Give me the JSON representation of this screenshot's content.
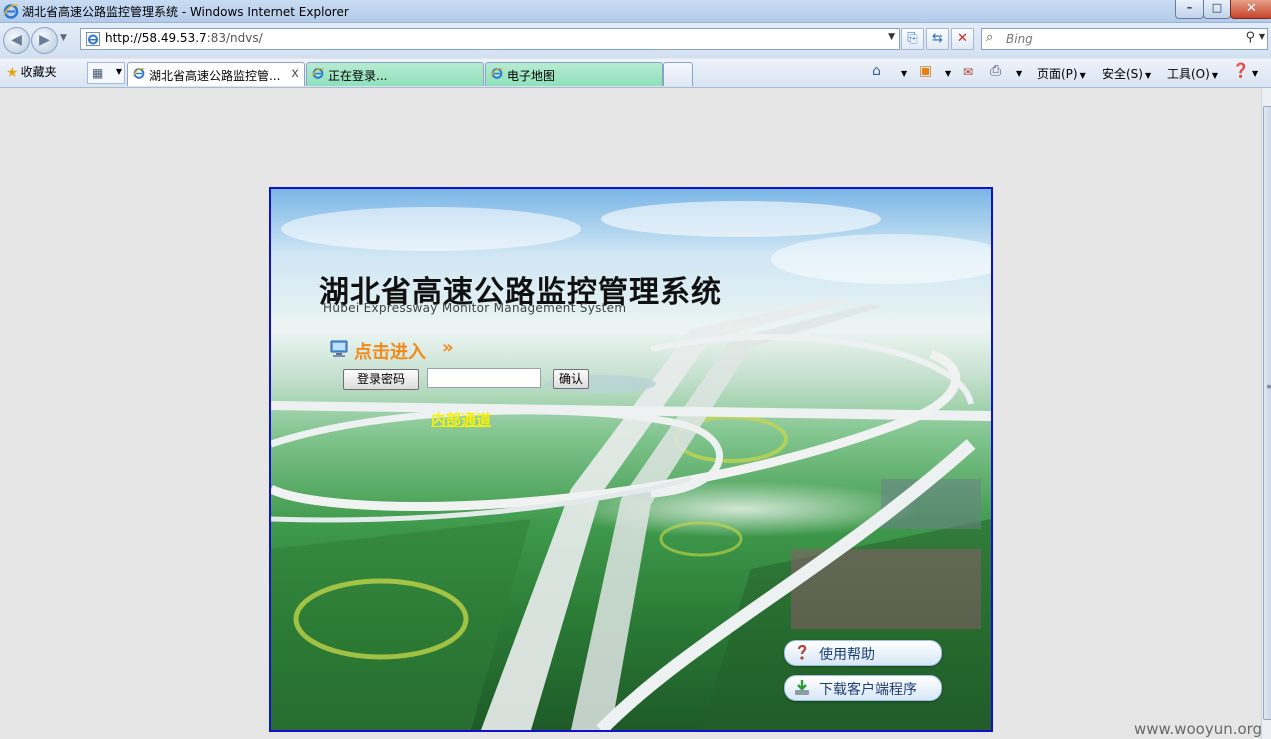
{
  "window": {
    "title": "湖北省高速公路监控管理系统 - Windows Internet Explorer",
    "controls": {
      "minimize": "–",
      "maximize": "□",
      "close": "✕"
    }
  },
  "address_bar": {
    "url_host": "http://58.49.53.7",
    "url_rest": ":83/ndvs/",
    "search_placeholder": "Bing"
  },
  "command_bar": {
    "favorites_label": "收藏夹",
    "tabs": [
      {
        "label": "湖北省高速公路监控管...",
        "active": true
      },
      {
        "label": "正在登录...",
        "active": false
      },
      {
        "label": "电子地图",
        "active": false
      }
    ],
    "page_menu": "页面(P)",
    "safety_menu": "安全(S)",
    "tools_menu": "工具(O)"
  },
  "login": {
    "system_title": "湖北省高速公路监控管理系统",
    "system_subtitle": "Hubei Expressway Monitor Management System",
    "enter_label": "点击进入",
    "enter_arrows": "»",
    "password_label": "登录密码",
    "password_value": "",
    "confirm_label": "确认",
    "internal_channel": "内部通道",
    "help_label": "使用帮助",
    "download_label": "下载客户端程序"
  },
  "watermark": "www.wooyun.org",
  "colors": {
    "enter_orange": "#f08a1c",
    "internal_yellow": "#f7f20a",
    "panel_border": "#1010d0",
    "inactive_tab_green": "#8fe0bb"
  }
}
